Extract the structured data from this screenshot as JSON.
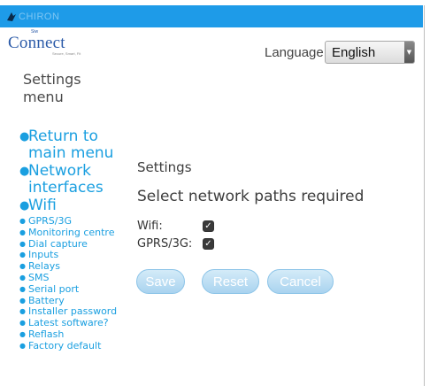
{
  "header": {
    "logo_text": "CHIRON",
    "brand_pre": "Siw",
    "brand_name": "Connect",
    "brand_sub": "Secure, Smart, Fit",
    "accent_color": "#1e9be8"
  },
  "language": {
    "label": "Language:",
    "selected": "English"
  },
  "sidebar": {
    "title": "Settings menu",
    "primary_items": [
      {
        "label": "Return to main menu"
      },
      {
        "label": "Network interfaces"
      },
      {
        "label": "Wifi"
      }
    ],
    "secondary_items": [
      {
        "label": "GPRS/3G"
      },
      {
        "label": "Monitoring centre"
      },
      {
        "label": "Dial capture"
      },
      {
        "label": "Inputs"
      },
      {
        "label": "Relays"
      },
      {
        "label": "SMS"
      },
      {
        "label": "Serial port"
      },
      {
        "label": "Battery"
      },
      {
        "label": "Installer password"
      },
      {
        "label": "Latest software?"
      },
      {
        "label": "Reflash"
      },
      {
        "label": "Factory default"
      }
    ],
    "link_color": "#1a9fe0"
  },
  "main": {
    "title": "Settings",
    "subtitle": "Select network paths required",
    "options": [
      {
        "label": "Wifi:",
        "checked": true
      },
      {
        "label": "GPRS/3G:",
        "checked": true
      }
    ],
    "buttons": {
      "save": "Save",
      "reset": "Reset",
      "cancel": "Cancel"
    }
  }
}
